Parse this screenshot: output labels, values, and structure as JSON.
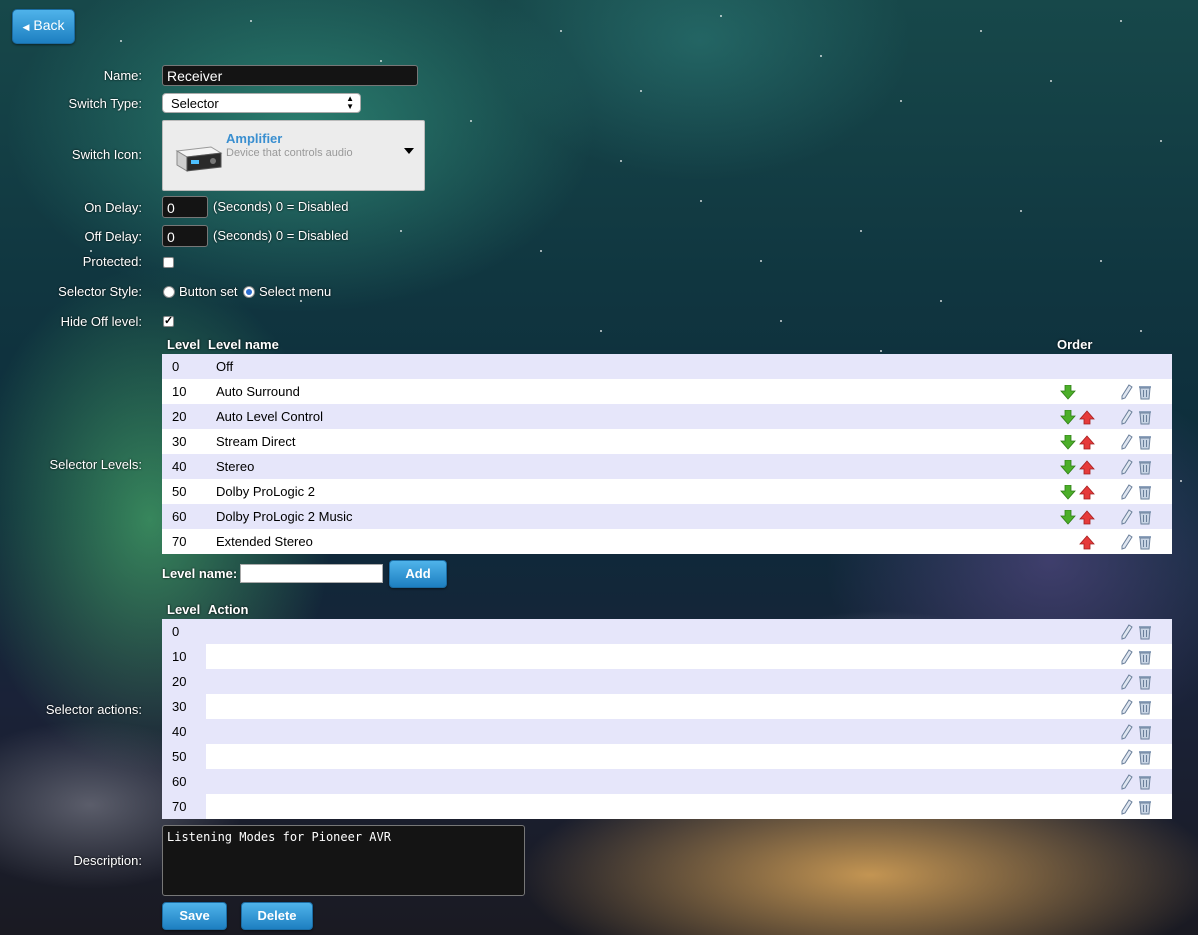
{
  "back_label": "Back",
  "form": {
    "name_label": "Name:",
    "name_value": "Receiver",
    "switch_type_label": "Switch Type:",
    "switch_type_value": "Selector",
    "switch_icon_label": "Switch Icon:",
    "icon_title": "Amplifier",
    "icon_subtitle": "Device that controls audio",
    "on_delay_label": "On Delay:",
    "on_delay_value": "0",
    "on_delay_hint": "(Seconds) 0 = Disabled",
    "off_delay_label": "Off Delay:",
    "off_delay_value": "0",
    "off_delay_hint": "(Seconds) 0 = Disabled",
    "protected_label": "Protected:",
    "protected_checked": false,
    "selector_style_label": "Selector Style:",
    "style_option_1": "Button set",
    "style_option_2": "Select menu",
    "style_selected": "Select menu",
    "hide_off_label": "Hide Off level:",
    "hide_off_checked": true,
    "selector_levels_label": "Selector Levels:",
    "selector_actions_label": "Selector actions:",
    "description_label": "Description:",
    "description_value": "Listening Modes for Pioneer AVR"
  },
  "levels_table": {
    "col_level": "Level",
    "col_name": "Level name",
    "col_order": "Order",
    "rows": [
      {
        "level": "0",
        "name": "Off",
        "down": false,
        "up": false,
        "ops": false
      },
      {
        "level": "10",
        "name": "Auto Surround",
        "down": true,
        "up": false,
        "ops": true
      },
      {
        "level": "20",
        "name": "Auto Level Control",
        "down": true,
        "up": true,
        "ops": true
      },
      {
        "level": "30",
        "name": "Stream Direct",
        "down": true,
        "up": true,
        "ops": true
      },
      {
        "level": "40",
        "name": "Stereo",
        "down": true,
        "up": true,
        "ops": true
      },
      {
        "level": "50",
        "name": "Dolby ProLogic 2",
        "down": true,
        "up": true,
        "ops": true
      },
      {
        "level": "60",
        "name": "Dolby ProLogic 2 Music",
        "down": true,
        "up": true,
        "ops": true
      },
      {
        "level": "70",
        "name": "Extended Stereo",
        "down": false,
        "up": true,
        "ops": true
      }
    ]
  },
  "add_level": {
    "label": "Level name:",
    "value": "",
    "button": "Add"
  },
  "actions_table": {
    "col_level": "Level",
    "col_action": "Action",
    "rows": [
      {
        "level": "0",
        "action": ""
      },
      {
        "level": "10",
        "action": ""
      },
      {
        "level": "20",
        "action": ""
      },
      {
        "level": "30",
        "action": ""
      },
      {
        "level": "40",
        "action": ""
      },
      {
        "level": "50",
        "action": ""
      },
      {
        "level": "60",
        "action": ""
      },
      {
        "level": "70",
        "action": ""
      }
    ]
  },
  "buttons": {
    "save": "Save",
    "delete": "Delete"
  },
  "colors": {
    "button_blue": "#2a8fd4",
    "row_shade": "#e6e6fa",
    "arrow_down": "#4caf2a",
    "arrow_up": "#e63b3b"
  }
}
